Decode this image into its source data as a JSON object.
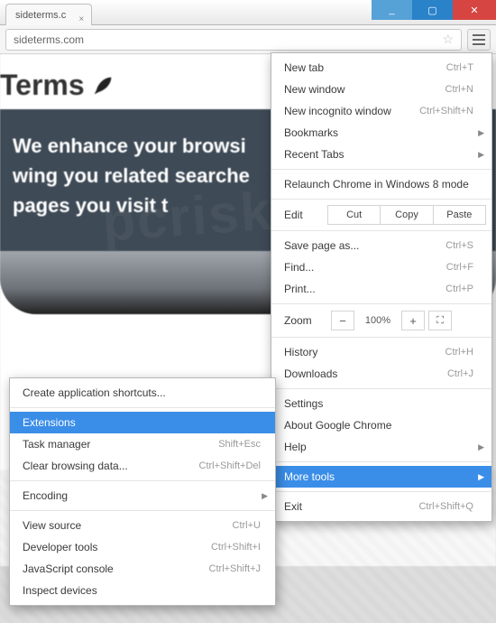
{
  "window": {
    "tab_title": "sideterms.c",
    "minimize": "_",
    "maximize": "▢",
    "close": "✕"
  },
  "omnibox": {
    "url": "sideterms.com",
    "star": "☆",
    "hamburger_name": "menu-icon"
  },
  "page": {
    "brand": "Terms",
    "hero_line1": "We enhance your browsi",
    "hero_line2": "wing you related searche",
    "hero_line3": "pages you visit t",
    "watermark": "pcrisk.com"
  },
  "menu": {
    "new_tab": {
      "label": "New tab",
      "short": "Ctrl+T"
    },
    "new_window": {
      "label": "New window",
      "short": "Ctrl+N"
    },
    "new_incognito": {
      "label": "New incognito window",
      "short": "Ctrl+Shift+N"
    },
    "bookmarks": {
      "label": "Bookmarks"
    },
    "recent_tabs": {
      "label": "Recent Tabs"
    },
    "relaunch": {
      "label": "Relaunch Chrome in Windows 8 mode"
    },
    "edit": {
      "label": "Edit",
      "cut": "Cut",
      "copy": "Copy",
      "paste": "Paste"
    },
    "save_as": {
      "label": "Save page as...",
      "short": "Ctrl+S"
    },
    "find": {
      "label": "Find...",
      "short": "Ctrl+F"
    },
    "print": {
      "label": "Print...",
      "short": "Ctrl+P"
    },
    "zoom": {
      "label": "Zoom",
      "value": "100%",
      "minus": "−",
      "plus": "+",
      "full": "⛶"
    },
    "history": {
      "label": "History",
      "short": "Ctrl+H"
    },
    "downloads": {
      "label": "Downloads",
      "short": "Ctrl+J"
    },
    "settings": {
      "label": "Settings"
    },
    "about": {
      "label": "About Google Chrome"
    },
    "help": {
      "label": "Help"
    },
    "more_tools": {
      "label": "More tools"
    },
    "exit": {
      "label": "Exit",
      "short": "Ctrl+Shift+Q"
    }
  },
  "submenu": {
    "create_shortcuts": {
      "label": "Create application shortcuts..."
    },
    "extensions": {
      "label": "Extensions"
    },
    "task_manager": {
      "label": "Task manager",
      "short": "Shift+Esc"
    },
    "clear_data": {
      "label": "Clear browsing data...",
      "short": "Ctrl+Shift+Del"
    },
    "encoding": {
      "label": "Encoding"
    },
    "view_source": {
      "label": "View source",
      "short": "Ctrl+U"
    },
    "developer_tools": {
      "label": "Developer tools",
      "short": "Ctrl+Shift+I"
    },
    "js_console": {
      "label": "JavaScript console",
      "short": "Ctrl+Shift+J"
    },
    "inspect_devices": {
      "label": "Inspect devices"
    }
  }
}
